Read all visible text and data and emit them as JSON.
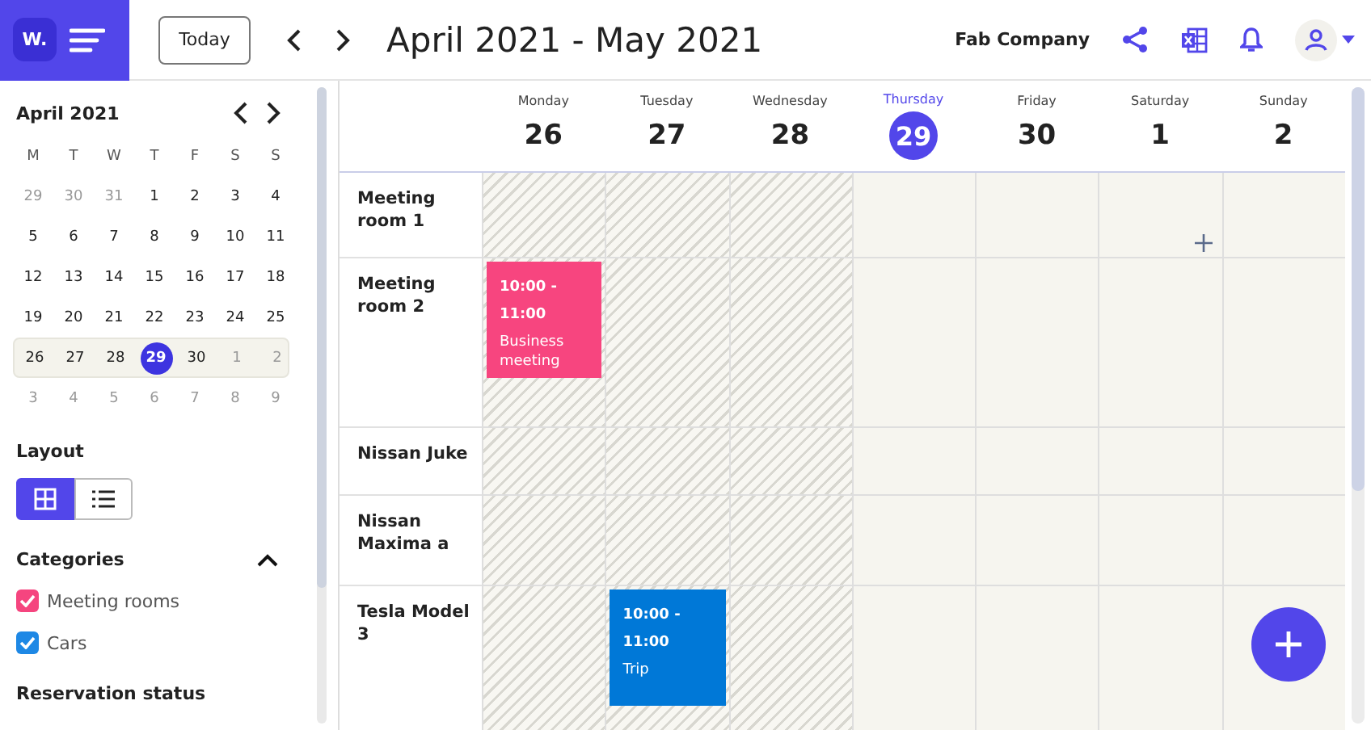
{
  "topbar": {
    "logo": "W.",
    "today_button": "Today",
    "range_title": "April 2021 - May 2021",
    "company": "Fab Company"
  },
  "mini_calendar": {
    "title": "April 2021",
    "weekdays": [
      "M",
      "T",
      "W",
      "T",
      "F",
      "S",
      "S"
    ],
    "weeks": [
      {
        "current": false,
        "days": [
          {
            "text": "29",
            "outside": true,
            "selected": false
          },
          {
            "text": "30",
            "outside": true,
            "selected": false
          },
          {
            "text": "31",
            "outside": true,
            "selected": false
          },
          {
            "text": "1",
            "outside": false,
            "selected": false
          },
          {
            "text": "2",
            "outside": false,
            "selected": false
          },
          {
            "text": "3",
            "outside": false,
            "selected": false
          },
          {
            "text": "4",
            "outside": false,
            "selected": false
          }
        ]
      },
      {
        "current": false,
        "days": [
          {
            "text": "5",
            "outside": false,
            "selected": false
          },
          {
            "text": "6",
            "outside": false,
            "selected": false
          },
          {
            "text": "7",
            "outside": false,
            "selected": false
          },
          {
            "text": "8",
            "outside": false,
            "selected": false
          },
          {
            "text": "9",
            "outside": false,
            "selected": false
          },
          {
            "text": "10",
            "outside": false,
            "selected": false
          },
          {
            "text": "11",
            "outside": false,
            "selected": false
          }
        ]
      },
      {
        "current": false,
        "days": [
          {
            "text": "12",
            "outside": false,
            "selected": false
          },
          {
            "text": "13",
            "outside": false,
            "selected": false
          },
          {
            "text": "14",
            "outside": false,
            "selected": false
          },
          {
            "text": "15",
            "outside": false,
            "selected": false
          },
          {
            "text": "16",
            "outside": false,
            "selected": false
          },
          {
            "text": "17",
            "outside": false,
            "selected": false
          },
          {
            "text": "18",
            "outside": false,
            "selected": false
          }
        ]
      },
      {
        "current": false,
        "days": [
          {
            "text": "19",
            "outside": false,
            "selected": false
          },
          {
            "text": "20",
            "outside": false,
            "selected": false
          },
          {
            "text": "21",
            "outside": false,
            "selected": false
          },
          {
            "text": "22",
            "outside": false,
            "selected": false
          },
          {
            "text": "23",
            "outside": false,
            "selected": false
          },
          {
            "text": "24",
            "outside": false,
            "selected": false
          },
          {
            "text": "25",
            "outside": false,
            "selected": false
          }
        ]
      },
      {
        "current": true,
        "days": [
          {
            "text": "26",
            "outside": false,
            "selected": false
          },
          {
            "text": "27",
            "outside": false,
            "selected": false
          },
          {
            "text": "28",
            "outside": false,
            "selected": false
          },
          {
            "text": "29",
            "outside": false,
            "selected": true
          },
          {
            "text": "30",
            "outside": false,
            "selected": false
          },
          {
            "text": "1",
            "outside": true,
            "selected": false
          },
          {
            "text": "2",
            "outside": true,
            "selected": false
          }
        ]
      },
      {
        "current": false,
        "days": [
          {
            "text": "3",
            "outside": true,
            "selected": false
          },
          {
            "text": "4",
            "outside": true,
            "selected": false
          },
          {
            "text": "5",
            "outside": true,
            "selected": false
          },
          {
            "text": "6",
            "outside": true,
            "selected": false
          },
          {
            "text": "7",
            "outside": true,
            "selected": false
          },
          {
            "text": "8",
            "outside": true,
            "selected": false
          },
          {
            "text": "9",
            "outside": true,
            "selected": false
          }
        ]
      }
    ]
  },
  "layout": {
    "title": "Layout",
    "options": [
      {
        "kind": "grid",
        "selected": true
      },
      {
        "kind": "list",
        "selected": false
      }
    ]
  },
  "categories": {
    "title": "Categories",
    "expanded": true,
    "items": [
      {
        "label": "Meeting rooms",
        "checked": true,
        "color": "#f5457f"
      },
      {
        "label": "Cars",
        "checked": true,
        "color": "#1e88e5"
      }
    ]
  },
  "reservation_status": {
    "title": "Reservation status"
  },
  "days": [
    {
      "name": "Monday",
      "number": "26",
      "selected": false,
      "past": true
    },
    {
      "name": "Tuesday",
      "number": "27",
      "selected": false,
      "past": true
    },
    {
      "name": "Wednesday",
      "number": "28",
      "selected": false,
      "past": true
    },
    {
      "name": "Thursday",
      "number": "29",
      "selected": true,
      "past": false
    },
    {
      "name": "Friday",
      "number": "30",
      "selected": false,
      "past": false
    },
    {
      "name": "Saturday",
      "number": "1",
      "selected": false,
      "past": false
    },
    {
      "name": "Sunday",
      "number": "2",
      "selected": false,
      "past": false
    }
  ],
  "resources": [
    {
      "name": "Meeting room 1",
      "cells": [
        {
          "hover": false
        },
        {
          "hover": false
        },
        {
          "hover": false
        },
        {
          "hover": false
        },
        {
          "hover": false
        },
        {
          "hover": true
        },
        {
          "hover": false
        }
      ]
    },
    {
      "name": "Meeting room 2",
      "cells": [
        {
          "hover": false,
          "event": {
            "time": "10:00 - 11:00",
            "title": "Business meeting",
            "color": "#f7457f"
          }
        },
        {
          "hover": false
        },
        {
          "hover": false
        },
        {
          "hover": false
        },
        {
          "hover": false
        },
        {
          "hover": false
        },
        {
          "hover": false
        }
      ]
    },
    {
      "name": "Nissan Juke",
      "cells": [
        {
          "hover": false
        },
        {
          "hover": false
        },
        {
          "hover": false
        },
        {
          "hover": false
        },
        {
          "hover": false
        },
        {
          "hover": false
        },
        {
          "hover": false
        }
      ]
    },
    {
      "name": "Nissan Maxima a",
      "cells": [
        {
          "hover": false
        },
        {
          "hover": false
        },
        {
          "hover": false
        },
        {
          "hover": false
        },
        {
          "hover": false
        },
        {
          "hover": false
        },
        {
          "hover": false
        }
      ]
    },
    {
      "name": "Tesla Model 3",
      "cells": [
        {
          "hover": false
        },
        {
          "hover": false,
          "event": {
            "time": "10:00 - 11:00",
            "title": "Trip",
            "color": "#0078d7"
          }
        },
        {
          "hover": false
        },
        {
          "hover": false
        },
        {
          "hover": false
        },
        {
          "hover": false
        },
        {
          "hover": false
        }
      ]
    }
  ]
}
